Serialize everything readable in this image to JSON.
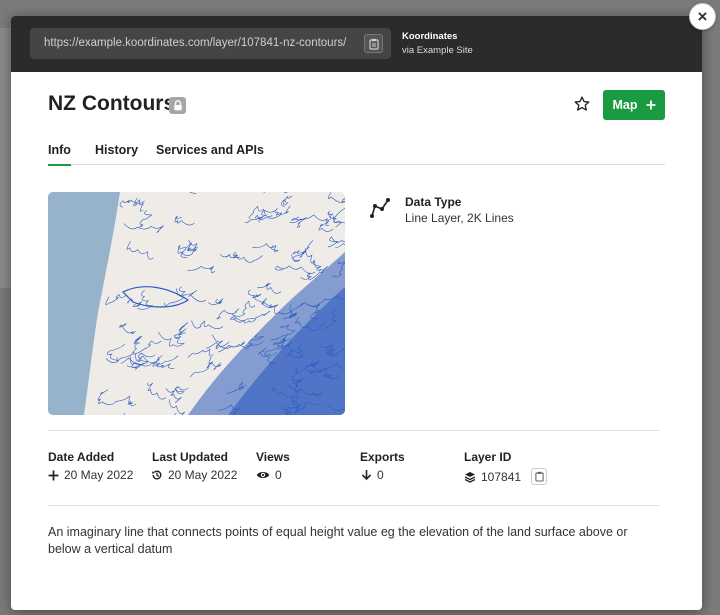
{
  "window": {
    "url": "https://example.koordinates.com/layer/107841-nz-contours/",
    "site_name": "Koordinates",
    "site_via": "via Example Site",
    "close_label": "×"
  },
  "header": {
    "title": "NZ Contours",
    "map_button_label": "Map",
    "map_button_icon": "plus-icon",
    "accent_color": "#1a9a41"
  },
  "tabs": [
    {
      "label": "Info",
      "active": true
    },
    {
      "label": "History",
      "active": false
    },
    {
      "label": "Services and APIs",
      "active": false
    }
  ],
  "data_type": {
    "label": "Data Type",
    "value": "Line Layer, 2K Lines",
    "icon": "polyline-icon"
  },
  "stats": {
    "date_added": {
      "label": "Date Added",
      "value": "20 May 2022",
      "icon": "plus-icon"
    },
    "last_updated": {
      "label": "Last Updated",
      "value": "20 May 2022",
      "icon": "history-icon"
    },
    "views": {
      "label": "Views",
      "value": "0",
      "icon": "eye-icon"
    },
    "exports": {
      "label": "Exports",
      "value": "0",
      "icon": "arrow-down-icon"
    },
    "layer_id": {
      "label": "Layer ID",
      "value": "107841",
      "icon": "layers-icon"
    }
  },
  "description": "An imaginary line that connects points of equal height value eg the elevation of the land surface above or below a vertical datum",
  "preview": {
    "sea_color": "#97b3cb",
    "land_color": "#efece7",
    "contour_color": "#2d5bc0"
  }
}
